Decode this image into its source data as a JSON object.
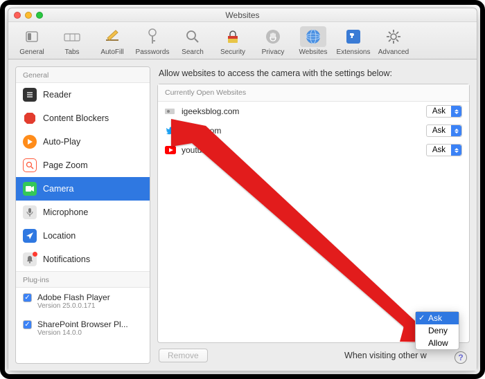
{
  "window": {
    "title": "Websites"
  },
  "toolbar": {
    "items": [
      {
        "label": "General"
      },
      {
        "label": "Tabs"
      },
      {
        "label": "AutoFill"
      },
      {
        "label": "Passwords"
      },
      {
        "label": "Search"
      },
      {
        "label": "Security"
      },
      {
        "label": "Privacy"
      },
      {
        "label": "Websites"
      },
      {
        "label": "Extensions"
      },
      {
        "label": "Advanced"
      }
    ]
  },
  "sidebar": {
    "groups": {
      "general": {
        "title": "General"
      },
      "plugins": {
        "title": "Plug-ins"
      }
    },
    "items": [
      {
        "label": "Reader"
      },
      {
        "label": "Content Blockers"
      },
      {
        "label": "Auto-Play"
      },
      {
        "label": "Page Zoom"
      },
      {
        "label": "Camera"
      },
      {
        "label": "Microphone"
      },
      {
        "label": "Location"
      },
      {
        "label": "Notifications"
      }
    ],
    "plugins": [
      {
        "name": "Adobe Flash Player",
        "version": "Version 25.0.0.171",
        "checked": true
      },
      {
        "name": "SharePoint Browser Pl...",
        "version": "Version 14.0.0",
        "checked": true
      }
    ]
  },
  "main": {
    "title": "Allow websites to access the camera with the settings below:",
    "panel_header": "Currently Open Websites",
    "sites": [
      {
        "name": "igeeksblog.com",
        "value": "Ask"
      },
      {
        "name": "twitter.com",
        "value": "Ask"
      },
      {
        "name": "youtube.com",
        "value": "Ask"
      }
    ],
    "remove": "Remove",
    "footer_label": "When visiting other w",
    "footer_value": "Ask"
  },
  "dropdown": {
    "options": [
      {
        "label": "Ask",
        "selected": true
      },
      {
        "label": "Deny",
        "selected": false
      },
      {
        "label": "Allow",
        "selected": false
      }
    ]
  }
}
